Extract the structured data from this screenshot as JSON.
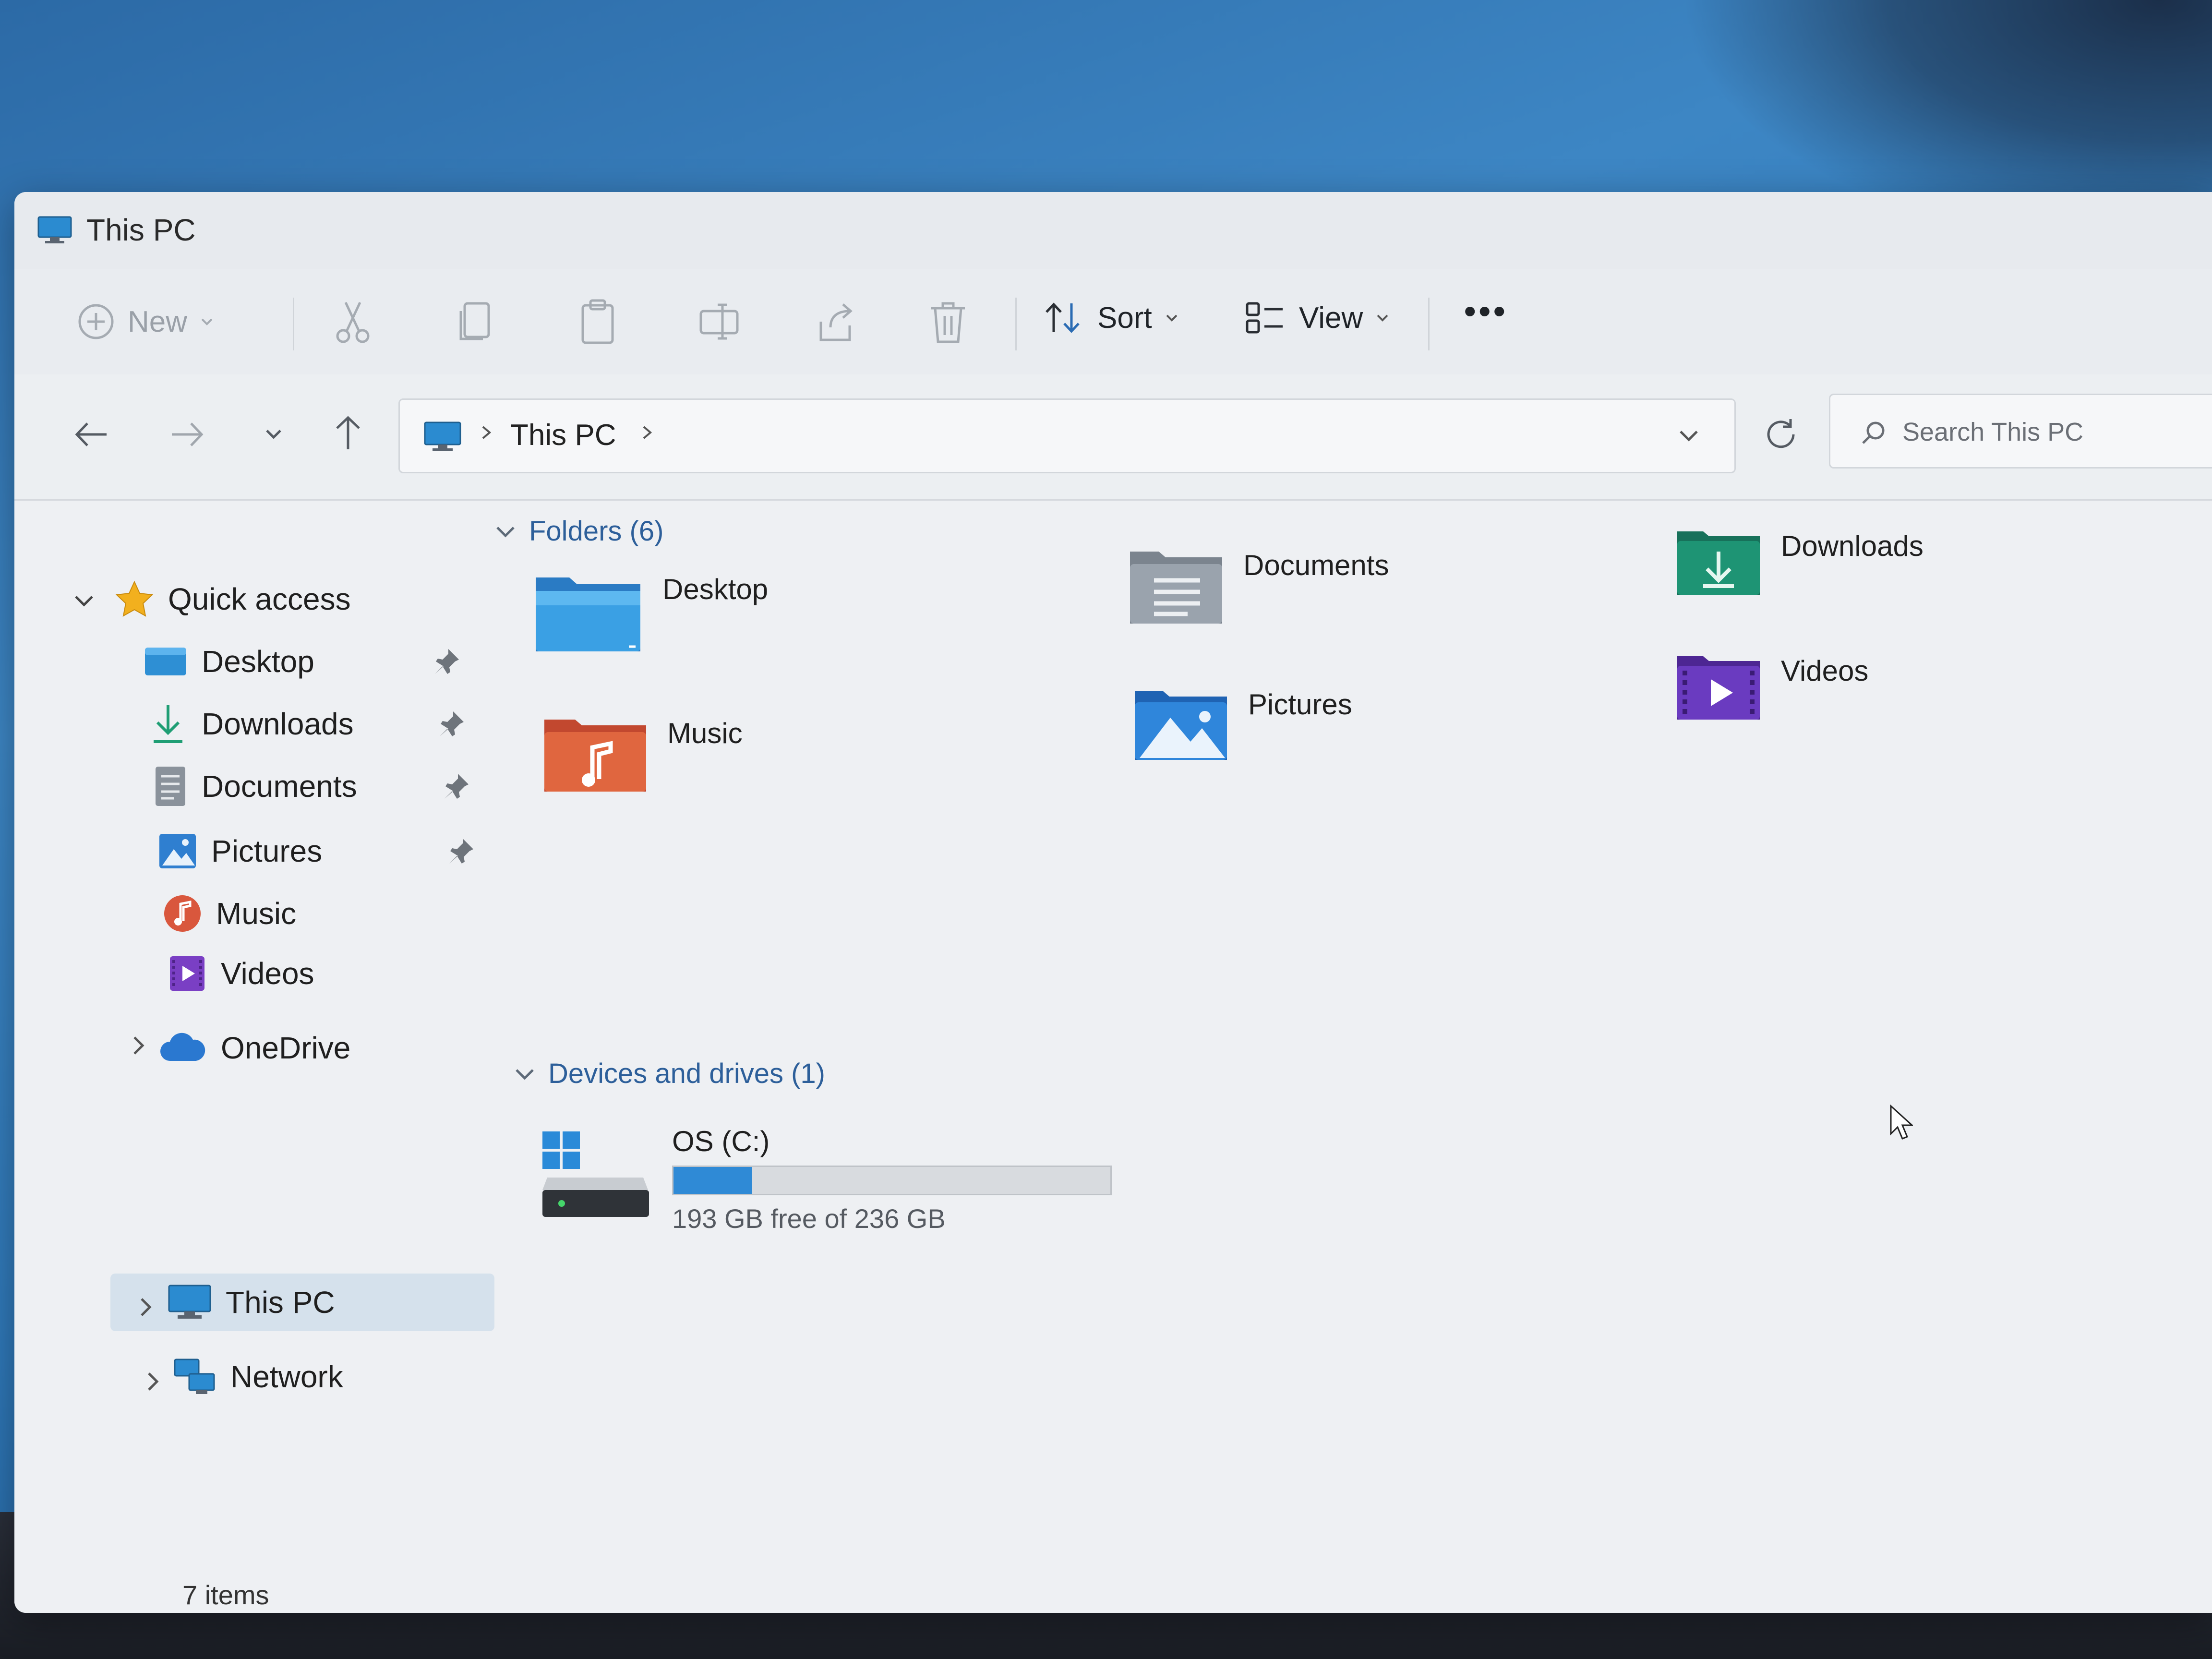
{
  "window": {
    "title": "This PC"
  },
  "toolbar": {
    "new_label": "New",
    "sort_label": "Sort",
    "view_label": "View",
    "more_label": "•••"
  },
  "address": {
    "crumbs": [
      "This PC"
    ],
    "search_placeholder": "Search This PC"
  },
  "sidebar": {
    "quick_access": "Quick access",
    "items": [
      {
        "label": "Desktop",
        "pinned": true
      },
      {
        "label": "Downloads",
        "pinned": true
      },
      {
        "label": "Documents",
        "pinned": true
      },
      {
        "label": "Pictures",
        "pinned": true
      },
      {
        "label": "Music",
        "pinned": false
      },
      {
        "label": "Videos",
        "pinned": false
      }
    ],
    "onedrive": "OneDrive",
    "this_pc": "This PC",
    "network": "Network"
  },
  "main": {
    "folders_header": "Folders (6)",
    "folders": [
      "Desktop",
      "Documents",
      "Downloads",
      "Music",
      "Pictures",
      "Videos"
    ],
    "devices_header": "Devices and drives (1)",
    "drive": {
      "name": "OS (C:)",
      "free_text": "193 GB free of 236 GB",
      "used_fraction": 0.18
    }
  },
  "status": {
    "items_count": "7 items"
  },
  "colors": {
    "accent": "#2f8ad6",
    "group_header": "#2d5f9a",
    "selected_bg": "#d5e1ec"
  }
}
